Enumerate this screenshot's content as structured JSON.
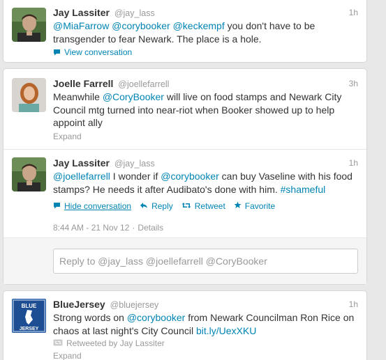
{
  "tweets": [
    {
      "fullname": "Jay Lassiter",
      "username": "@jay_lass",
      "time": "1h",
      "text_parts": [
        {
          "t": "@MiaFarrow",
          "link": true
        },
        {
          "t": " ",
          "link": false
        },
        {
          "t": "@corybooker",
          "link": true
        },
        {
          "t": " ",
          "link": false
        },
        {
          "t": "@keckempf",
          "link": true
        },
        {
          "t": " you don't have to be transgender to fear Newark. The place is a hole.",
          "link": false
        }
      ],
      "footer": "View conversation"
    },
    {
      "fullname": "Joelle Farrell",
      "username": "@joellefarrell",
      "time": "3h",
      "text_parts": [
        {
          "t": "Meanwhile ",
          "link": false
        },
        {
          "t": "@CoryBooker",
          "link": true
        },
        {
          "t": " will live on food stamps and Newark City Council mtg turned into near-riot when Booker showed up to help appoint ally",
          "link": false
        }
      ],
      "footer": "Expand"
    },
    {
      "fullname": "Jay Lassiter",
      "username": "@jay_lass",
      "time": "1h",
      "text_parts": [
        {
          "t": "@joellefarrell",
          "link": true
        },
        {
          "t": " I wonder if ",
          "link": false
        },
        {
          "t": "@corybooker",
          "link": true
        },
        {
          "t": " can buy Vaseline with his food stamps? He needs it after Audibato's done with him. ",
          "link": false
        },
        {
          "t": "#shameful",
          "link": true
        }
      ],
      "actions": {
        "hide": "Hide conversation",
        "reply": "Reply",
        "retweet": "Retweet",
        "favorite": "Favorite"
      },
      "timestamp": "8:44 AM - 21 Nov 12",
      "details": "Details",
      "reply_text": "Reply to @jay_lass @joellefarrell @CoryBooker"
    },
    {
      "fullname": "BlueJersey",
      "username": "@bluejersey",
      "time": "1h",
      "text_parts": [
        {
          "t": "Strong words on ",
          "link": false
        },
        {
          "t": "@corybooker",
          "link": true
        },
        {
          "t": " from Newark Councilman Ron Rice on chaos at last night's City Council ",
          "link": false
        },
        {
          "t": "bit.ly/UexXKU",
          "link": true
        }
      ],
      "retweeted_by": "Retweeted by Jay Lassiter",
      "footer": "Expand",
      "logo_text": {
        "top": "BLUE",
        "bottom": "JERSEY"
      }
    }
  ]
}
